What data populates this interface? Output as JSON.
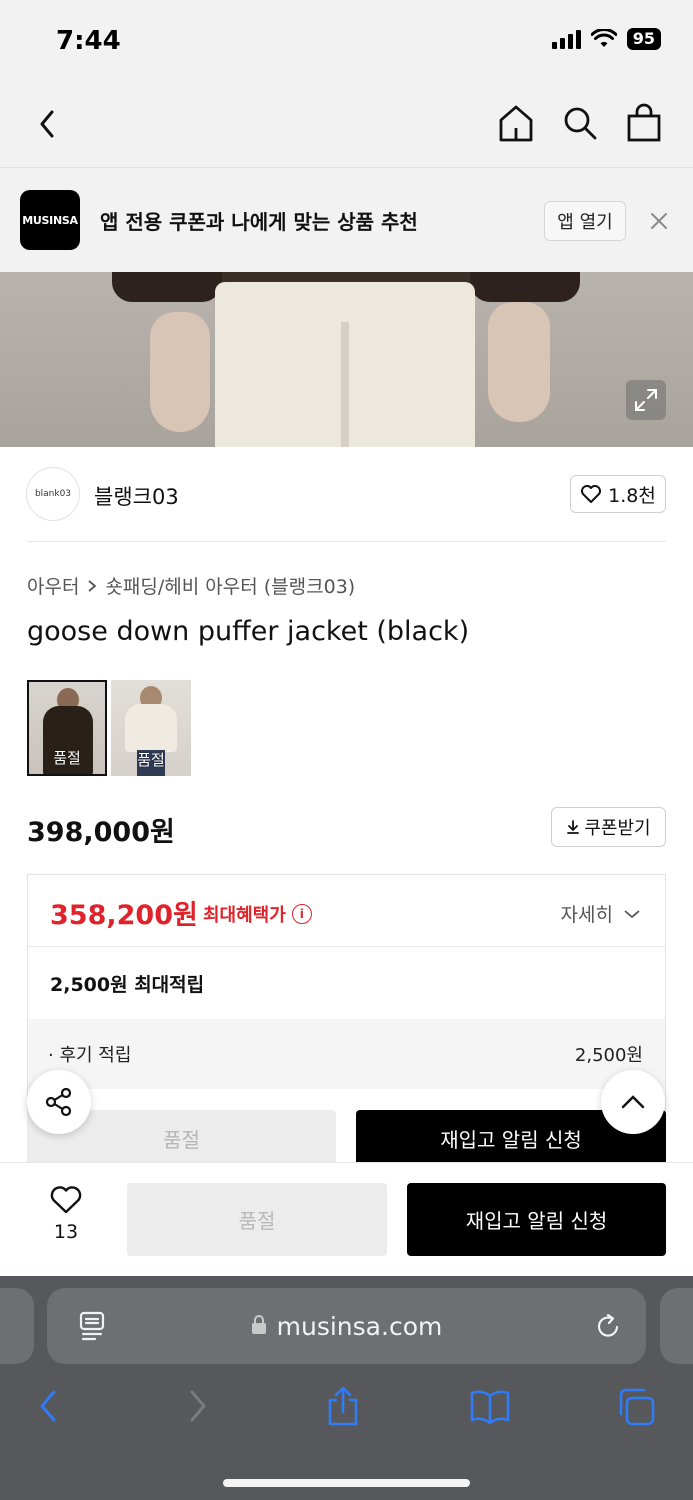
{
  "status_bar": {
    "time": "7:44",
    "battery": "95"
  },
  "app_banner": {
    "logo_text": "MUSINSA",
    "text": "앱 전용 쿠폰과 나에게 맞는 상품 추천",
    "open_label": "앱 열기"
  },
  "brand": {
    "logo_text": "blank03",
    "name": "블랭크03",
    "like_count": "1.8천"
  },
  "breadcrumb": {
    "category": "아우터",
    "subcategory": "숏패딩/헤비 아우터 (블랭크03)"
  },
  "product": {
    "title": "goose down puffer jacket (black)",
    "thumbnails": [
      {
        "label": "품절",
        "selected": true
      },
      {
        "label": "품절",
        "selected": false
      }
    ],
    "price": "398,000원",
    "coupon_label": "쿠폰받기"
  },
  "benefits": {
    "max_price": "358,200원",
    "max_label": "최대혜택가",
    "detail_label": "자세히",
    "points": "2,500원 최대적립",
    "review_label": "· 후기 적립",
    "review_value": "2,500원"
  },
  "ghost_buttons": {
    "soldout": "품절",
    "restock": "재입고 알림 신청"
  },
  "action_bar": {
    "like_count": "13",
    "soldout": "품절",
    "restock": "재입고 알림 신청"
  },
  "safari": {
    "url": "musinsa.com"
  },
  "colors": {
    "accent_red": "#e0232b",
    "black": "#000000",
    "ios_blue": "#2f7cf6"
  }
}
